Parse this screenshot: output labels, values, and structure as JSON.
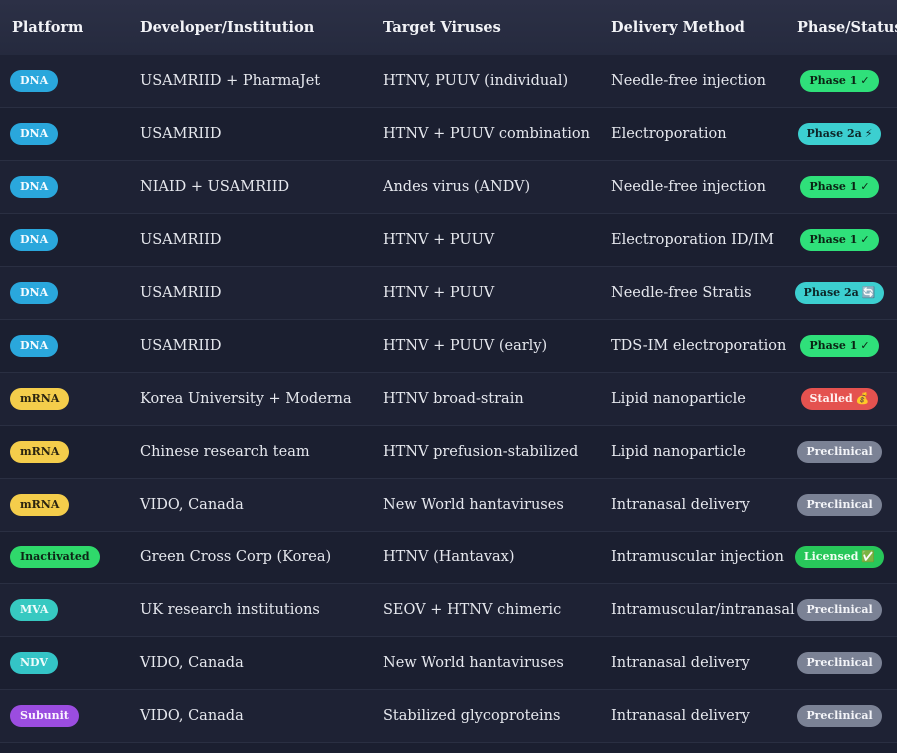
{
  "headers": {
    "platform": "Platform",
    "developer": "Developer/Institution",
    "target": "Target Viruses",
    "delivery": "Delivery Method",
    "phase": "Phase/Status"
  },
  "rows": [
    {
      "platform": "DNA",
      "platform_kind": "dna",
      "developer": "USAMRIID + PharmaJet",
      "target": "HTNV, PUUV (individual)",
      "delivery": "Needle-free injection",
      "status": "Phase 1",
      "status_kind": "p1",
      "status_icon": "✓"
    },
    {
      "platform": "DNA",
      "platform_kind": "dna",
      "developer": "USAMRIID",
      "target": "HTNV + PUUV combination",
      "delivery": "Electroporation",
      "status": "Phase 2a",
      "status_kind": "p2",
      "status_icon": "⚡"
    },
    {
      "platform": "DNA",
      "platform_kind": "dna",
      "developer": "NIAID + USAMRIID",
      "target": "Andes virus (ANDV)",
      "delivery": "Needle-free injection",
      "status": "Phase 1",
      "status_kind": "p1",
      "status_icon": "✓"
    },
    {
      "platform": "DNA",
      "platform_kind": "dna",
      "developer": "USAMRIID",
      "target": "HTNV + PUUV",
      "delivery": "Electroporation ID/IM",
      "status": "Phase 1",
      "status_kind": "p1",
      "status_icon": "✓"
    },
    {
      "platform": "DNA",
      "platform_kind": "dna",
      "developer": "USAMRIID",
      "target": "HTNV + PUUV",
      "delivery": "Needle-free Stratis",
      "status": "Phase 2a",
      "status_kind": "p2",
      "status_icon": "🔄"
    },
    {
      "platform": "DNA",
      "platform_kind": "dna",
      "developer": "USAMRIID",
      "target": "HTNV + PUUV (early)",
      "delivery": "TDS-IM electroporation",
      "status": "Phase 1",
      "status_kind": "p1",
      "status_icon": "✓"
    },
    {
      "platform": "mRNA",
      "platform_kind": "mrna",
      "developer": "Korea University + Moderna",
      "target": "HTNV broad-strain",
      "delivery": "Lipid nanoparticle",
      "status": "Stalled",
      "status_kind": "stalled",
      "status_icon": "💰"
    },
    {
      "platform": "mRNA",
      "platform_kind": "mrna",
      "developer": "Chinese research team",
      "target": "HTNV prefusion-stabilized",
      "delivery": "Lipid nanoparticle",
      "status": "Preclinical",
      "status_kind": "pre",
      "status_icon": ""
    },
    {
      "platform": "mRNA",
      "platform_kind": "mrna",
      "developer": "VIDO, Canada",
      "target": "New World hantaviruses",
      "delivery": "Intranasal delivery",
      "status": "Preclinical",
      "status_kind": "pre",
      "status_icon": ""
    },
    {
      "platform": "Inactivated",
      "platform_kind": "inact",
      "developer": "Green Cross Corp (Korea)",
      "target": "HTNV (Hantavax)",
      "delivery": "Intramuscular injection",
      "status": "Licensed",
      "status_kind": "lic",
      "status_icon": "✅"
    },
    {
      "platform": "MVA",
      "platform_kind": "mva",
      "developer": "UK research institutions",
      "target": "SEOV + HTNV chimeric",
      "delivery": "Intramuscular/intranasal",
      "status": "Preclinical",
      "status_kind": "pre",
      "status_icon": ""
    },
    {
      "platform": "NDV",
      "platform_kind": "ndv",
      "developer": "VIDO, Canada",
      "target": "New World hantaviruses",
      "delivery": "Intranasal delivery",
      "status": "Preclinical",
      "status_kind": "pre",
      "status_icon": ""
    },
    {
      "platform": "Subunit",
      "platform_kind": "sub",
      "developer": "VIDO, Canada",
      "target": "Stabilized glycoproteins",
      "delivery": "Intranasal delivery",
      "status": "Preclinical",
      "status_kind": "pre",
      "status_icon": ""
    }
  ],
  "colors": {
    "dna": "#2aa7dc",
    "mrna": "#f4cd4b",
    "inactivated": "#2fd96b",
    "mva": "#37c9c1",
    "ndv": "#34c4c6",
    "subunit": "#9b4de0",
    "phase1": "#2fe07a",
    "phase2a": "#3ccfd0",
    "stalled": "#e4524f",
    "preclinical": "#7b8295",
    "licensed": "#28c75a"
  }
}
